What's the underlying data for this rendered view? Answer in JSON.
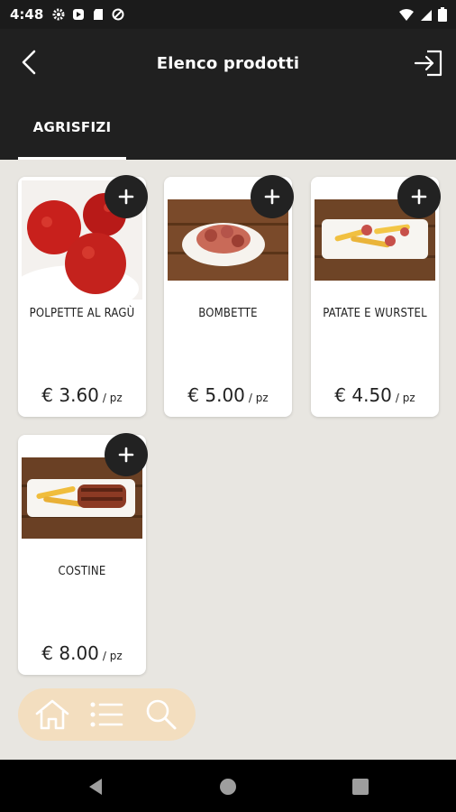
{
  "status": {
    "time": "4:48"
  },
  "appbar": {
    "title": "Elenco prodotti"
  },
  "tabs": [
    {
      "label": "AGRISFIZI"
    }
  ],
  "products": [
    {
      "name": "POLPETTE AL RAGÙ",
      "price": "€ 3.60",
      "unit": "/ pz",
      "image": "meatballs-image"
    },
    {
      "name": "BOMBETTE",
      "price": "€ 5.00",
      "unit": "/ pz",
      "image": "bombette-plate-image"
    },
    {
      "name": "PATATE E WURSTEL",
      "price": "€ 4.50",
      "unit": "/ pz",
      "image": "fries-wurstel-image"
    },
    {
      "name": "COSTINE",
      "price": "€ 8.00",
      "unit": "/ pz",
      "image": "ribs-fries-image"
    }
  ],
  "bottom_nav": {
    "items": [
      "home-icon",
      "list-icon",
      "search-icon"
    ]
  },
  "colors": {
    "appbar": "#202020",
    "background": "#e8e6e1",
    "pill": "#f3debf",
    "button": "#222222"
  }
}
